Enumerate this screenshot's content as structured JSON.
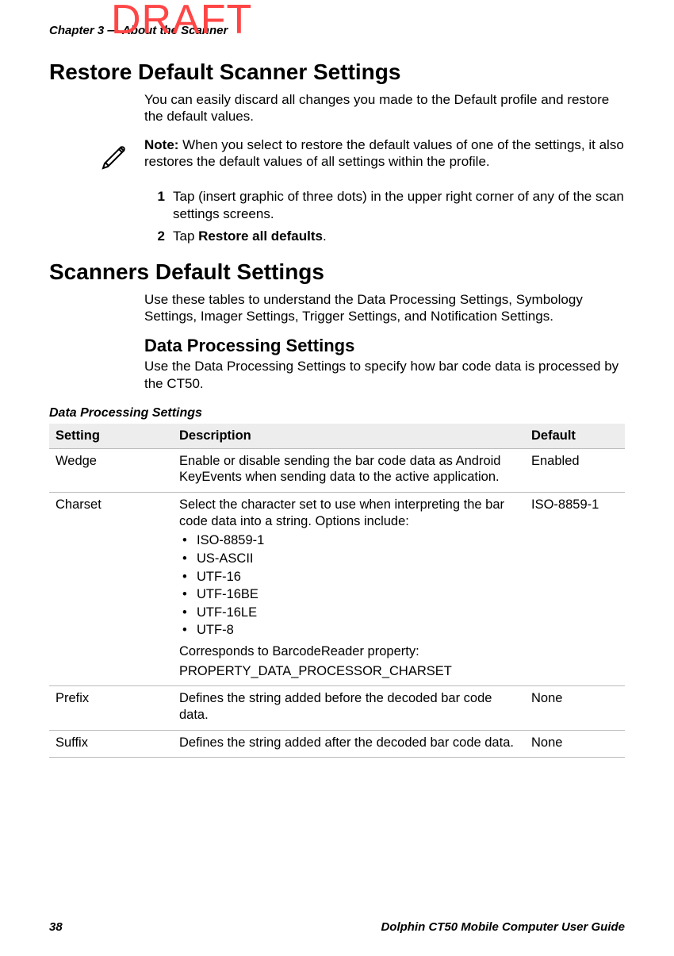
{
  "watermark": "DRAFT",
  "running_head": "Chapter 3 — About the Scanner",
  "section1": {
    "title": "Restore Default Scanner Settings",
    "intro": "You can easily discard all changes you made to the Default profile and restore the default values.",
    "note_label": "Note:",
    "note_body": " When you select to restore the default values of one of the settings, it also restores the default values of all settings within the profile.",
    "steps": [
      {
        "num": "1",
        "text_before": "Tap (insert graphic of three dots) in the upper right corner of any of the scan settings screens.",
        "bold": "",
        "text_after": ""
      },
      {
        "num": "2",
        "text_before": "Tap ",
        "bold": "Restore all defaults",
        "text_after": "."
      }
    ]
  },
  "section2": {
    "title": "Scanners Default Settings",
    "intro": "Use these tables to understand the Data Processing Settings, Symbology Settings, Imager Settings, Trigger Settings, and Notification Settings.",
    "subtitle": "Data Processing Settings",
    "subintro": "Use the Data Processing Settings to specify how bar code data is processed by the CT50."
  },
  "table": {
    "caption": "Data Processing Settings",
    "headers": {
      "setting": "Setting",
      "description": "Description",
      "def": "Default"
    },
    "rows": [
      {
        "setting": "Wedge",
        "desc_intro": "Enable or disable sending the bar code data as Android KeyEvents when sending data to the active application.",
        "options": [],
        "desc_outro1": "",
        "desc_outro2": "",
        "def": "Enabled"
      },
      {
        "setting": "Charset",
        "desc_intro": "Select the character set to use when interpreting the bar code data into a string. Options include:",
        "options": [
          "ISO-8859-1",
          "US-ASCII",
          "UTF-16",
          "UTF-16BE",
          "UTF-16LE",
          "UTF-8"
        ],
        "desc_outro1": "Corresponds to BarcodeReader property:",
        "desc_outro2": "PROPERTY_DATA_PROCESSOR_CHARSET",
        "def": "ISO-8859-1"
      },
      {
        "setting": "Prefix",
        "desc_intro": "Defines the string added before the decoded bar code data.",
        "options": [],
        "desc_outro1": "",
        "desc_outro2": "",
        "def": "None"
      },
      {
        "setting": "Suffix",
        "desc_intro": "Defines the string added after the decoded bar code data.",
        "options": [],
        "desc_outro1": "",
        "desc_outro2": "",
        "def": "None"
      }
    ]
  },
  "footer": {
    "page": "38",
    "guide": "Dolphin CT50 Mobile Computer User Guide"
  }
}
